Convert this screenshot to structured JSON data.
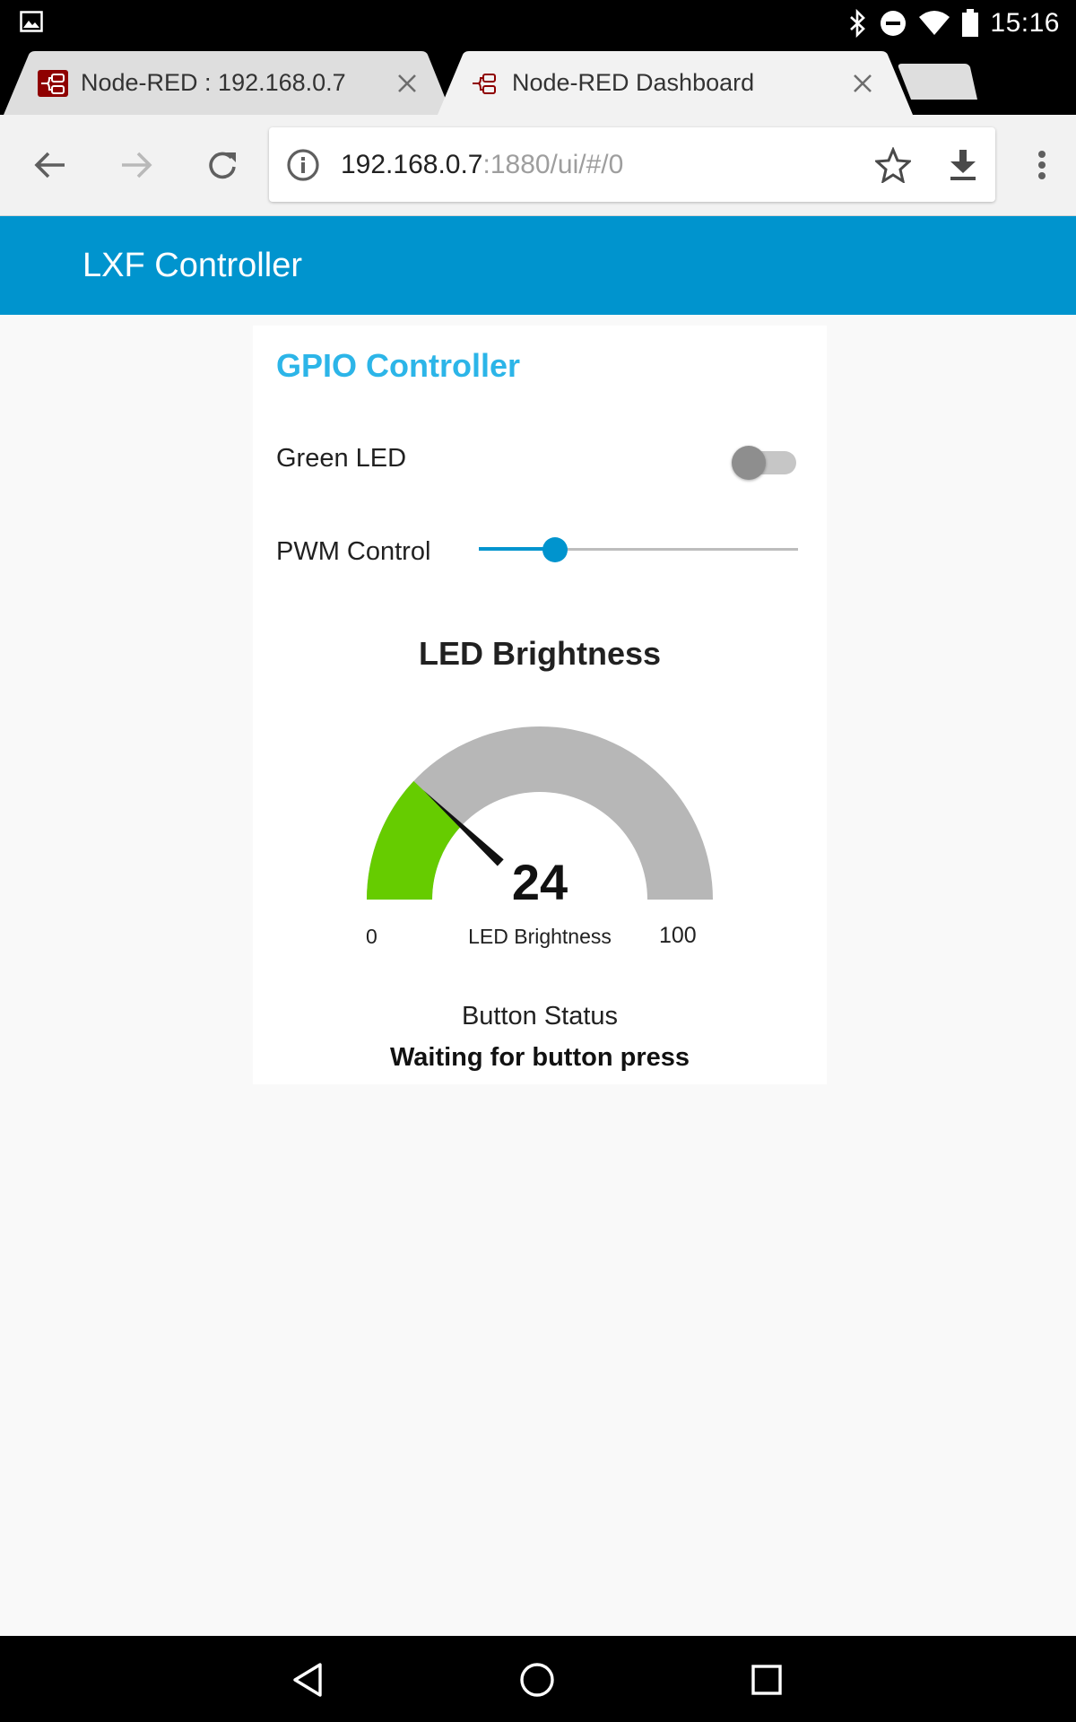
{
  "status_bar": {
    "time": "15:16",
    "left_icon": "image-notification-icon",
    "icons": [
      "bluetooth-icon",
      "do-not-disturb-icon",
      "wifi-icon",
      "battery-icon"
    ]
  },
  "tabs": [
    {
      "title": "Node-RED : 192.168.0.7",
      "favicon": "node-red-icon",
      "active": false
    },
    {
      "title": "Node-RED Dashboard",
      "favicon": "node-red-icon",
      "active": true
    }
  ],
  "toolbar": {
    "url_host": "192.168.0.7",
    "url_path": ":1880/ui/#/0"
  },
  "app": {
    "title": "LXF Controller",
    "header_color": "#0094ce"
  },
  "card": {
    "title": "GPIO Controller",
    "title_color": "#2cb5e8",
    "switch": {
      "label": "Green LED",
      "on": false
    },
    "slider": {
      "label": "PWM Control",
      "value": 24,
      "min": 0,
      "max": 100
    },
    "gauge": {
      "title": "LED Brightness",
      "value": "24",
      "units": "LED Brightness",
      "min": "0",
      "max": "100",
      "fill_color": "#66cc00",
      "track_color": "#b7b7b7"
    },
    "text_output": {
      "label": "Button Status",
      "value": "Waiting for button press"
    }
  },
  "nav_bar": {
    "buttons": [
      "back-triangle-icon",
      "home-circle-icon",
      "recents-square-icon"
    ]
  }
}
